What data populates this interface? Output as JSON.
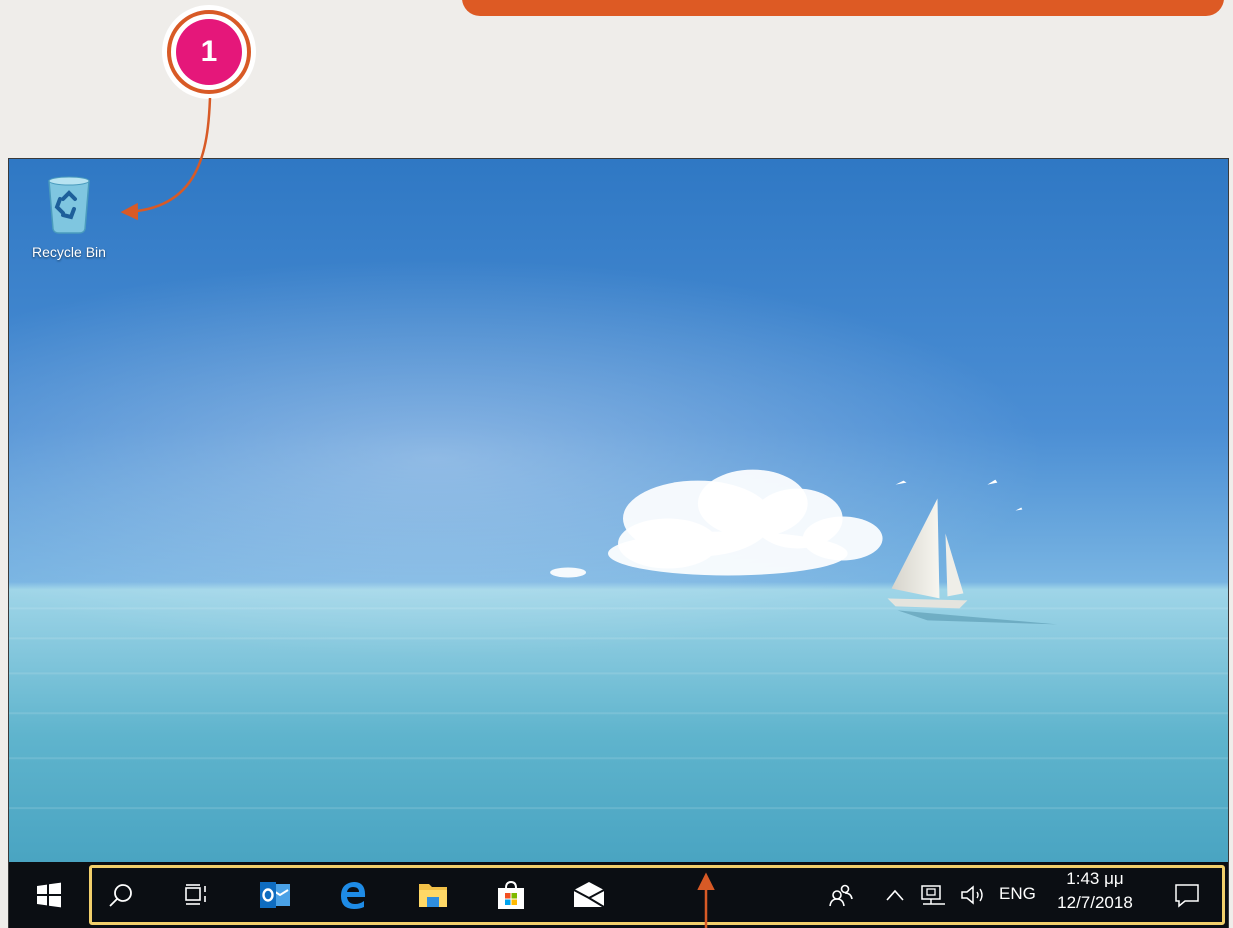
{
  "callout": {
    "number": "1"
  },
  "desktop": {
    "icons": [
      {
        "label": "Recycle Bin",
        "icon": "recycle-bin-icon"
      }
    ]
  },
  "taskbar": {
    "pinned": [
      {
        "name": "search",
        "icon": "search-icon"
      },
      {
        "name": "task-view",
        "icon": "task-view-icon"
      },
      {
        "name": "outlook",
        "icon": "outlook-icon"
      },
      {
        "name": "edge",
        "icon": "edge-icon"
      },
      {
        "name": "file-explorer",
        "icon": "folder-icon"
      },
      {
        "name": "store",
        "icon": "store-icon"
      },
      {
        "name": "mail",
        "icon": "mail-icon"
      }
    ],
    "tray": {
      "language": "ENG",
      "time": "1:43 μμ",
      "date": "12/7/2018"
    }
  },
  "colors": {
    "banner": "#dd5a24",
    "callout_fill": "#e5177a",
    "callout_ring": "#d85a26",
    "taskbar": "#0b0e13",
    "taskbar_highlight": "#f2cf6b"
  }
}
